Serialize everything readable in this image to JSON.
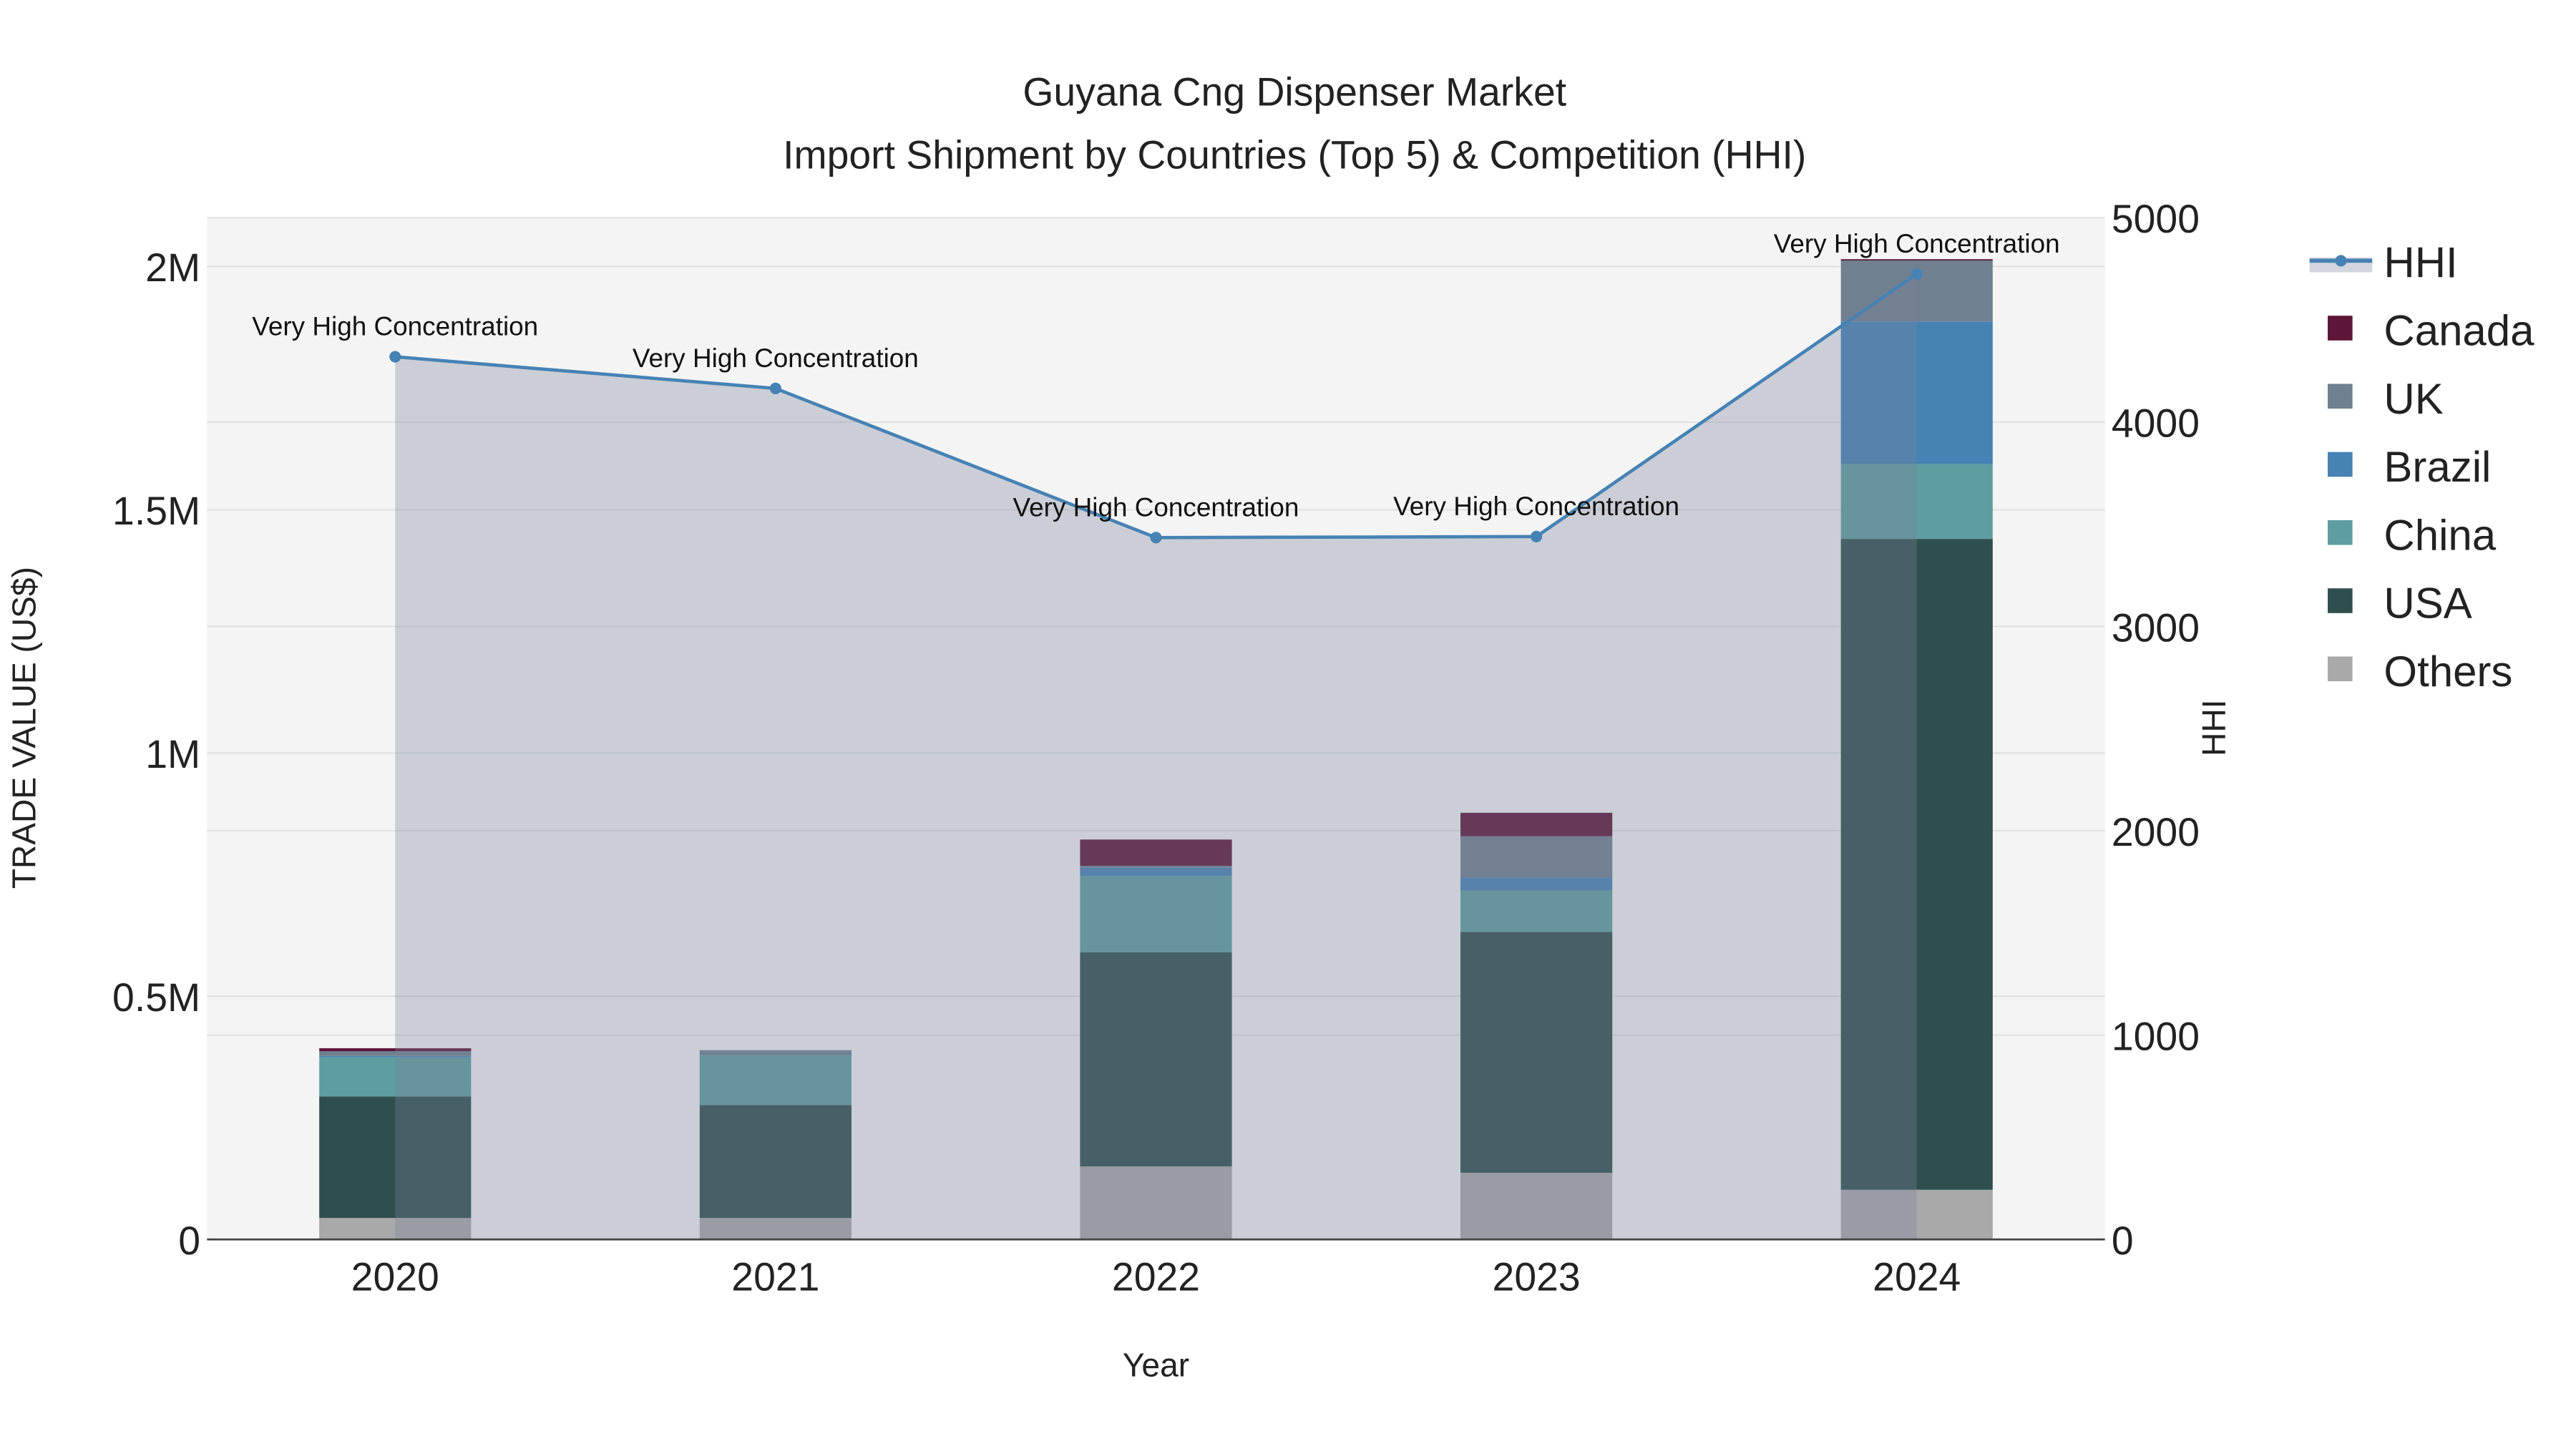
{
  "chart_data": {
    "type": "bar",
    "title": "Guyana Cng Dispenser Market",
    "subtitle": "Import Shipment by Countries (Top 5) & Competition (HHI)",
    "xlabel": "Year",
    "ylabel": "TRADE VALUE (US$)",
    "y2label": "HHI",
    "categories": [
      "2020",
      "2021",
      "2022",
      "2023",
      "2024"
    ],
    "ylim": [
      0,
      2100000
    ],
    "y2lim": [
      0,
      5000
    ],
    "yticks": [
      {
        "v": 0,
        "label": "0"
      },
      {
        "v": 500000,
        "label": "0.5M"
      },
      {
        "v": 1000000,
        "label": "1M"
      },
      {
        "v": 1500000,
        "label": "1.5M"
      },
      {
        "v": 2000000,
        "label": "2M"
      }
    ],
    "y2ticks": [
      {
        "v": 0,
        "label": "0"
      },
      {
        "v": 1000,
        "label": "1000"
      },
      {
        "v": 2000,
        "label": "2000"
      },
      {
        "v": 3000,
        "label": "3000"
      },
      {
        "v": 4000,
        "label": "4000"
      },
      {
        "v": 5000,
        "label": "5000"
      }
    ],
    "stacked": true,
    "series": [
      {
        "name": "Others",
        "color": "#a9a9a9",
        "values": [
          44000,
          44000,
          150000,
          137000,
          102000
        ]
      },
      {
        "name": "USA",
        "color": "#2f4f4f",
        "values": [
          250000,
          232000,
          440000,
          495000,
          1338000
        ]
      },
      {
        "name": "China",
        "color": "#5f9ea0",
        "values": [
          80000,
          103000,
          157000,
          85000,
          154000
        ]
      },
      {
        "name": "Brazil",
        "color": "#4682b4",
        "values": [
          3000,
          0,
          17000,
          27000,
          293000
        ]
      },
      {
        "name": "UK",
        "color": "#708090",
        "values": [
          10000,
          10000,
          4000,
          85000,
          126000
        ]
      },
      {
        "name": "Canada",
        "color": "#5e1638",
        "values": [
          6000,
          0,
          54000,
          48000,
          2000
        ]
      }
    ],
    "hhi": {
      "name": "HHI",
      "color": "#4682b4",
      "values": [
        4320,
        4165,
        3435,
        3440,
        4725
      ],
      "annotations": [
        "Very High Concentration",
        "Very High Concentration",
        "Very High Concentration",
        "Very High Concentration",
        "Very High Concentration"
      ]
    },
    "legend": [
      "HHI",
      "Canada",
      "UK",
      "Brazil",
      "China",
      "USA",
      "Others"
    ],
    "legend_position": "right",
    "grid": true
  }
}
